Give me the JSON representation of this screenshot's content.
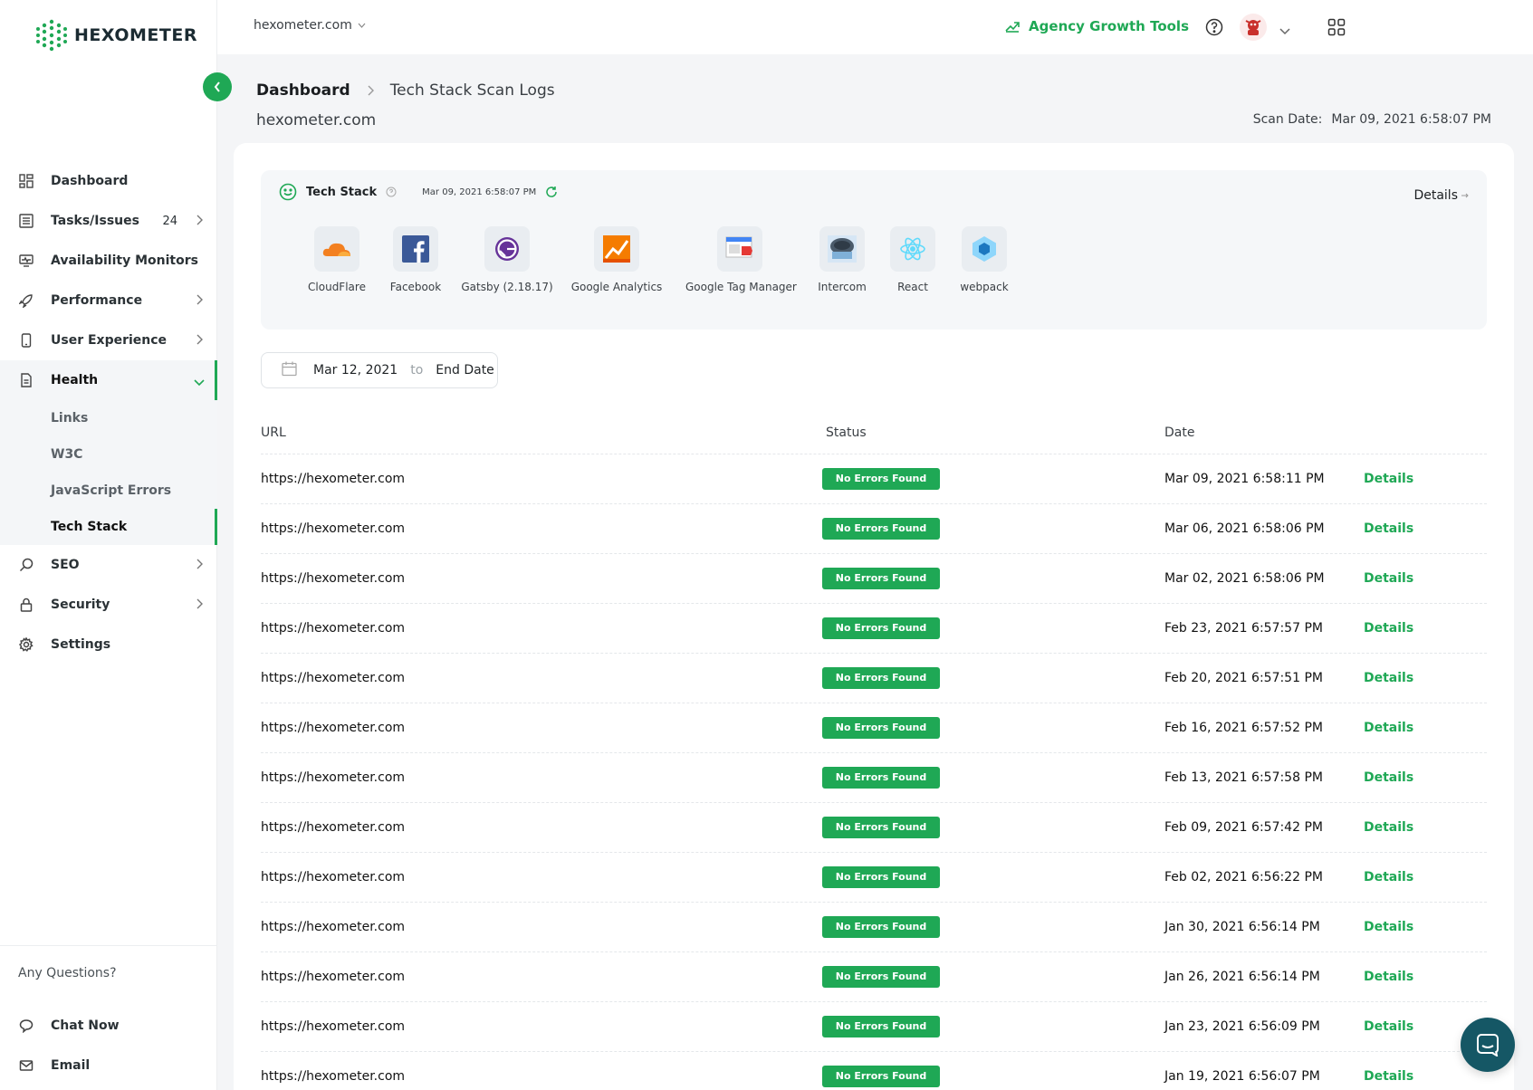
{
  "brand": {
    "name": "HEXOMETER",
    "accent": "#1fa855"
  },
  "topbar": {
    "domain": "hexometer.com",
    "growth_label": "Agency Growth Tools"
  },
  "sidebar": {
    "items": [
      {
        "label": "Dashboard",
        "icon": "dashboard-icon"
      },
      {
        "label": "Tasks/Issues",
        "count": "24",
        "icon": "tasks-icon"
      },
      {
        "label": "Availability Monitors",
        "icon": "monitor-icon"
      },
      {
        "label": "Performance",
        "icon": "rocket-icon"
      },
      {
        "label": "User Experience",
        "icon": "mobile-icon"
      },
      {
        "label": "Health",
        "icon": "document-icon"
      },
      {
        "label": "SEO",
        "icon": "search-icon"
      },
      {
        "label": "Security",
        "icon": "lock-icon"
      },
      {
        "label": "Settings",
        "icon": "gear-icon"
      }
    ],
    "health_sub": [
      "Links",
      "W3C",
      "JavaScript Errors",
      "Tech Stack"
    ],
    "questions": "Any Questions?",
    "chat": "Chat Now",
    "email": "Email"
  },
  "header": {
    "breadcrumb_home": "Dashboard",
    "breadcrumb_current": "Tech Stack Scan Logs",
    "site": "hexometer.com",
    "scan_date_label": "Scan Date:",
    "scan_date_value": "Mar 09, 2021 6:58:07 PM"
  },
  "tech_stack": {
    "title": "Tech Stack",
    "date": "Mar 09, 2021 6:58:07 PM",
    "details": "Details",
    "tools": [
      "CloudFlare",
      "Facebook",
      "Gatsby (2.18.17)",
      "Google Analytics",
      "Google Tag Manager",
      "Intercom",
      "React",
      "webpack"
    ]
  },
  "filter": {
    "start": "Mar 12, 2021",
    "to": "to",
    "end": "End Date"
  },
  "table": {
    "headers": {
      "url": "URL",
      "status": "Status",
      "date": "Date"
    },
    "action_label": "Details",
    "rows": [
      {
        "url": "https://hexometer.com",
        "status": "No Errors Found",
        "date": "Mar 09, 2021 6:58:11 PM"
      },
      {
        "url": "https://hexometer.com",
        "status": "No Errors Found",
        "date": "Mar 06, 2021 6:58:06 PM"
      },
      {
        "url": "https://hexometer.com",
        "status": "No Errors Found",
        "date": "Mar 02, 2021 6:58:06 PM"
      },
      {
        "url": "https://hexometer.com",
        "status": "No Errors Found",
        "date": "Feb 23, 2021 6:57:57 PM"
      },
      {
        "url": "https://hexometer.com",
        "status": "No Errors Found",
        "date": "Feb 20, 2021 6:57:51 PM"
      },
      {
        "url": "https://hexometer.com",
        "status": "No Errors Found",
        "date": "Feb 16, 2021 6:57:52 PM"
      },
      {
        "url": "https://hexometer.com",
        "status": "No Errors Found",
        "date": "Feb 13, 2021 6:57:58 PM"
      },
      {
        "url": "https://hexometer.com",
        "status": "No Errors Found",
        "date": "Feb 09, 2021 6:57:42 PM"
      },
      {
        "url": "https://hexometer.com",
        "status": "No Errors Found",
        "date": "Feb 02, 2021 6:56:22 PM"
      },
      {
        "url": "https://hexometer.com",
        "status": "No Errors Found",
        "date": "Jan 30, 2021 6:56:14 PM"
      },
      {
        "url": "https://hexometer.com",
        "status": "No Errors Found",
        "date": "Jan 26, 2021 6:56:14 PM"
      },
      {
        "url": "https://hexometer.com",
        "status": "No Errors Found",
        "date": "Jan 23, 2021 6:56:09 PM"
      },
      {
        "url": "https://hexometer.com",
        "status": "No Errors Found",
        "date": "Jan 19, 2021 6:56:07 PM"
      }
    ]
  }
}
